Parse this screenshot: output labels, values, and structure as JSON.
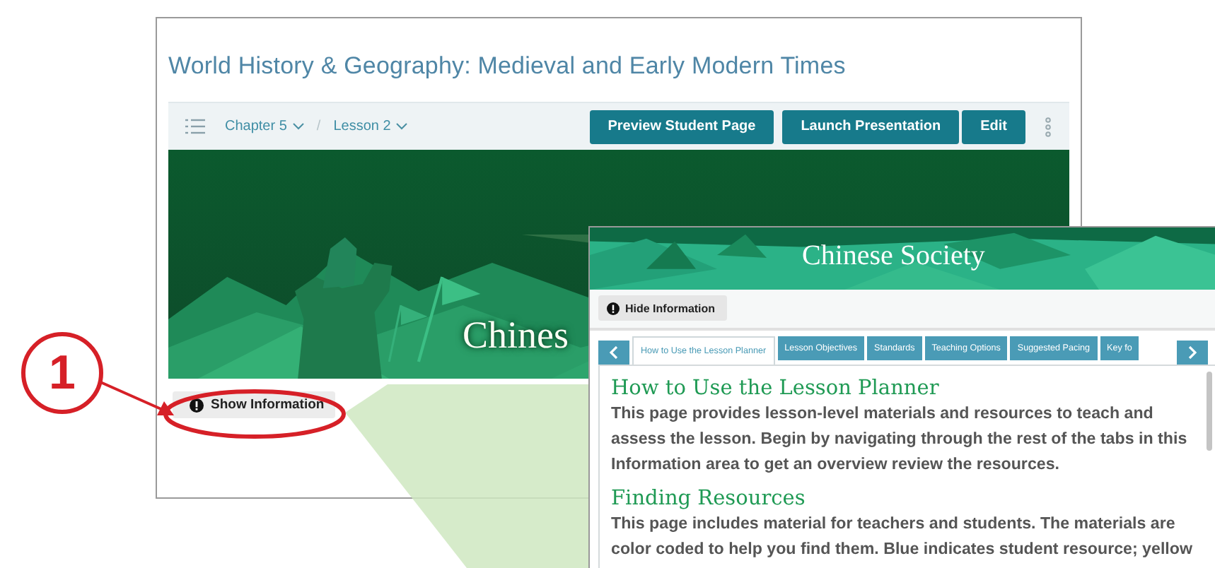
{
  "main": {
    "title": "World History & Geography: Medieval and Early Modern Times",
    "breadcrumb": [
      {
        "label": "Chapter 5"
      },
      {
        "label": "Lesson 2"
      }
    ],
    "separator": "/",
    "buttons": [
      "Preview Student Page",
      "Launch Presentation",
      "Edit"
    ],
    "banner": {
      "title": "Chines"
    },
    "info_button": "Show Information"
  },
  "callout": {
    "number": "1"
  },
  "detail": {
    "title": "Chinese Society",
    "info_button": "Hide Information",
    "tabs": [
      {
        "label": "How to Use the Lesson Planner",
        "selected": true
      },
      {
        "label": "Lesson Objectives",
        "selected": false
      },
      {
        "label": "Standards",
        "selected": false
      },
      {
        "label": "Teaching Options",
        "selected": false
      },
      {
        "label": "Suggested Pacing",
        "selected": false
      },
      {
        "label": "Key fo",
        "selected": false
      }
    ],
    "sections": [
      {
        "heading": "How to Use the Lesson Planner",
        "text": "This page provides lesson-level materials and resources to teach and assess the lesson. Begin by navigating through the rest of the tabs in this Information area to get an overview review the resources."
      },
      {
        "heading": "Finding Resources",
        "text": "This page includes material for teachers and students. The materials are color coded to help you find them. Blue indicates student resource; yellow"
      }
    ]
  }
}
